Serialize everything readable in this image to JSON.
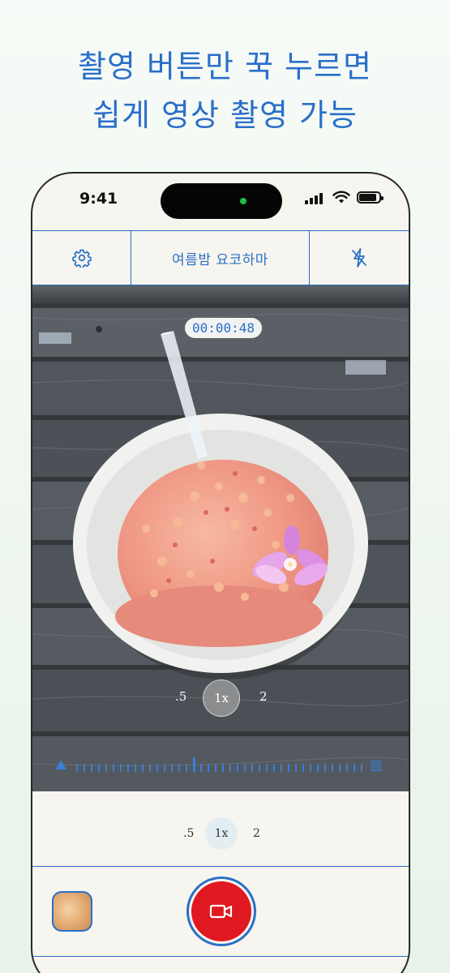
{
  "promo": {
    "line1": "촬영 버튼만 꾹 누르면",
    "line2": "쉽게 영상 촬영 가능"
  },
  "status_bar": {
    "time": "9:41"
  },
  "toolbar": {
    "settings_icon": "gear-icon",
    "title": "여름밤 요코하마",
    "flash_icon": "flash-off-icon"
  },
  "viewfinder": {
    "timer": "00:00:48",
    "zoom": {
      "options": [
        ".5",
        "1x",
        "2"
      ],
      "selected": "1x"
    },
    "ruler_icons": [
      "landscape-icon",
      "building-icon"
    ]
  },
  "lens_zoom": {
    "options": [
      ".5",
      "1x",
      "2"
    ],
    "selected": "1x"
  },
  "controls": {
    "gallery_icon": "gallery-thumbnail",
    "record_icon": "video-camera-icon"
  },
  "colors": {
    "accent": "#2a6fc9",
    "record": "#e0181f",
    "background": "#f7f5ef"
  }
}
